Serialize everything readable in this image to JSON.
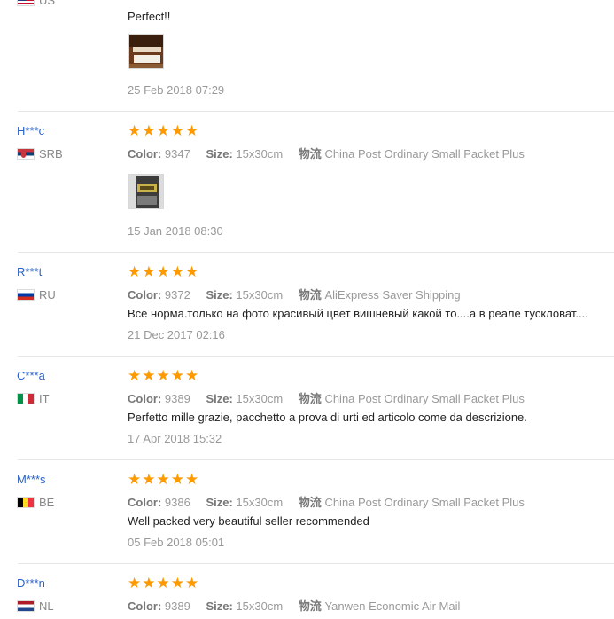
{
  "top_review": {
    "country_code": "US",
    "text": "Perfect!!",
    "date": "25 Feb 2018 07:29"
  },
  "labels": {
    "color": "Color:",
    "size": "Size:",
    "logistics": "物流"
  },
  "reviews": [
    {
      "user": "H***c",
      "country": "SRB",
      "flag": "serbia-flag-icon",
      "rating": 5,
      "color": "9347",
      "size": "15x30cm",
      "shipping": "China Post Ordinary Small Packet Plus",
      "text": "",
      "has_photo": true,
      "date": "15 Jan 2018 08:30"
    },
    {
      "user": "R***t",
      "country": "RU",
      "flag": "russia-flag-icon",
      "rating": 5,
      "color": "9372",
      "size": "15x30cm",
      "shipping": "AliExpress Saver Shipping",
      "text": "Все норма.только на фото красивый цвет вишневый какой то....а в реале тускловат....",
      "has_photo": false,
      "date": "21 Dec 2017 02:16"
    },
    {
      "user": "C***a",
      "country": "IT",
      "flag": "italy-flag-icon",
      "rating": 5,
      "color": "9389",
      "size": "15x30cm",
      "shipping": "China Post Ordinary Small Packet Plus",
      "text": "Perfetto mille grazie, pacchetto a prova di urti ed articolo come da descrizione.",
      "has_photo": false,
      "date": "17 Apr 2018 15:32"
    },
    {
      "user": "M***s",
      "country": "BE",
      "flag": "belgium-flag-icon",
      "rating": 5,
      "color": "9386",
      "size": "15x30cm",
      "shipping": "China Post Ordinary Small Packet Plus",
      "text": "Well packed very beautiful seller recommended",
      "has_photo": false,
      "date": "05 Feb 2018 05:01"
    },
    {
      "user": "D***n",
      "country": "NL",
      "flag": "netherlands-flag-icon",
      "rating": 5,
      "color": "9389",
      "size": "15x30cm",
      "shipping": "Yanwen Economic Air Mail",
      "text": "",
      "has_photo": false,
      "date": ""
    }
  ],
  "colors": {
    "link": "#2a63c6",
    "star": "#ff9900",
    "divider": "#e6e6e6"
  }
}
